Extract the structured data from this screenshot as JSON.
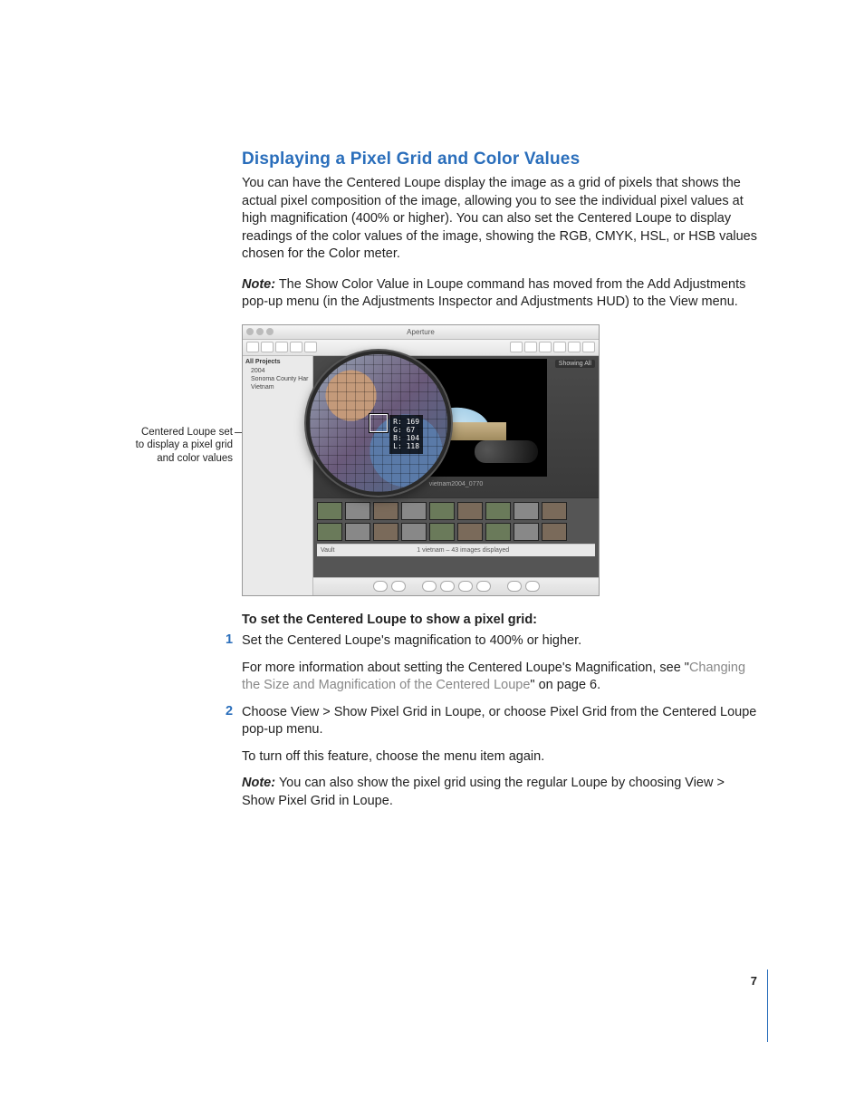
{
  "section": {
    "title": "Displaying a Pixel Grid and Color Values",
    "intro": "You can have the Centered Loupe display the image as a grid of pixels that shows the actual pixel composition of the image, allowing you to see the individual pixel values at high magnification (400% or higher). You can also set the Centered Loupe to display readings of the color values of the image, showing the RGB, CMYK, HSL, or HSB values chosen for the Color meter.",
    "note1_label": "Note:",
    "note1_text": "  The Show Color Value in Loupe command has moved from the Add Adjustments pop-up menu (in the Adjustments Inspector and Adjustments HUD) to the View menu."
  },
  "figure": {
    "callout": "Centered Loupe set to display a pixel grid and color values",
    "app_title": "Aperture",
    "sidebar_header": "All Projects",
    "sidebar_items": [
      "2004",
      "Sonoma County Har",
      "Vietnam"
    ],
    "photo_label": "vietnam2004_0770",
    "readout": {
      "r": "R: 169",
      "g": "G: 67",
      "b": "B: 104",
      "l": "L: 118"
    },
    "status_left": "Vault",
    "status_center": "1 vietnam – 43 images displayed",
    "viewer_badge": "Showing All"
  },
  "instructions": {
    "heading": "To set the Centered Loupe to show a pixel grid:",
    "step1_a": "Set the Centered Loupe's magnification to 400% or higher.",
    "step1_b_pre": "For more information about setting the Centered Loupe's Magnification, see \"",
    "step1_b_link": "Changing the Size and Magnification of the Centered Loupe",
    "step1_b_post": "\" on page 6.",
    "step2_a": "Choose View > Show Pixel Grid in Loupe, or choose Pixel Grid from the Centered Loupe pop-up menu.",
    "step2_b": "To turn off this feature, choose the menu item again.",
    "note2_label": "Note:",
    "note2_text": "  You can also show the pixel grid using the regular Loupe by choosing View > Show Pixel Grid in Loupe."
  },
  "page_number": "7"
}
